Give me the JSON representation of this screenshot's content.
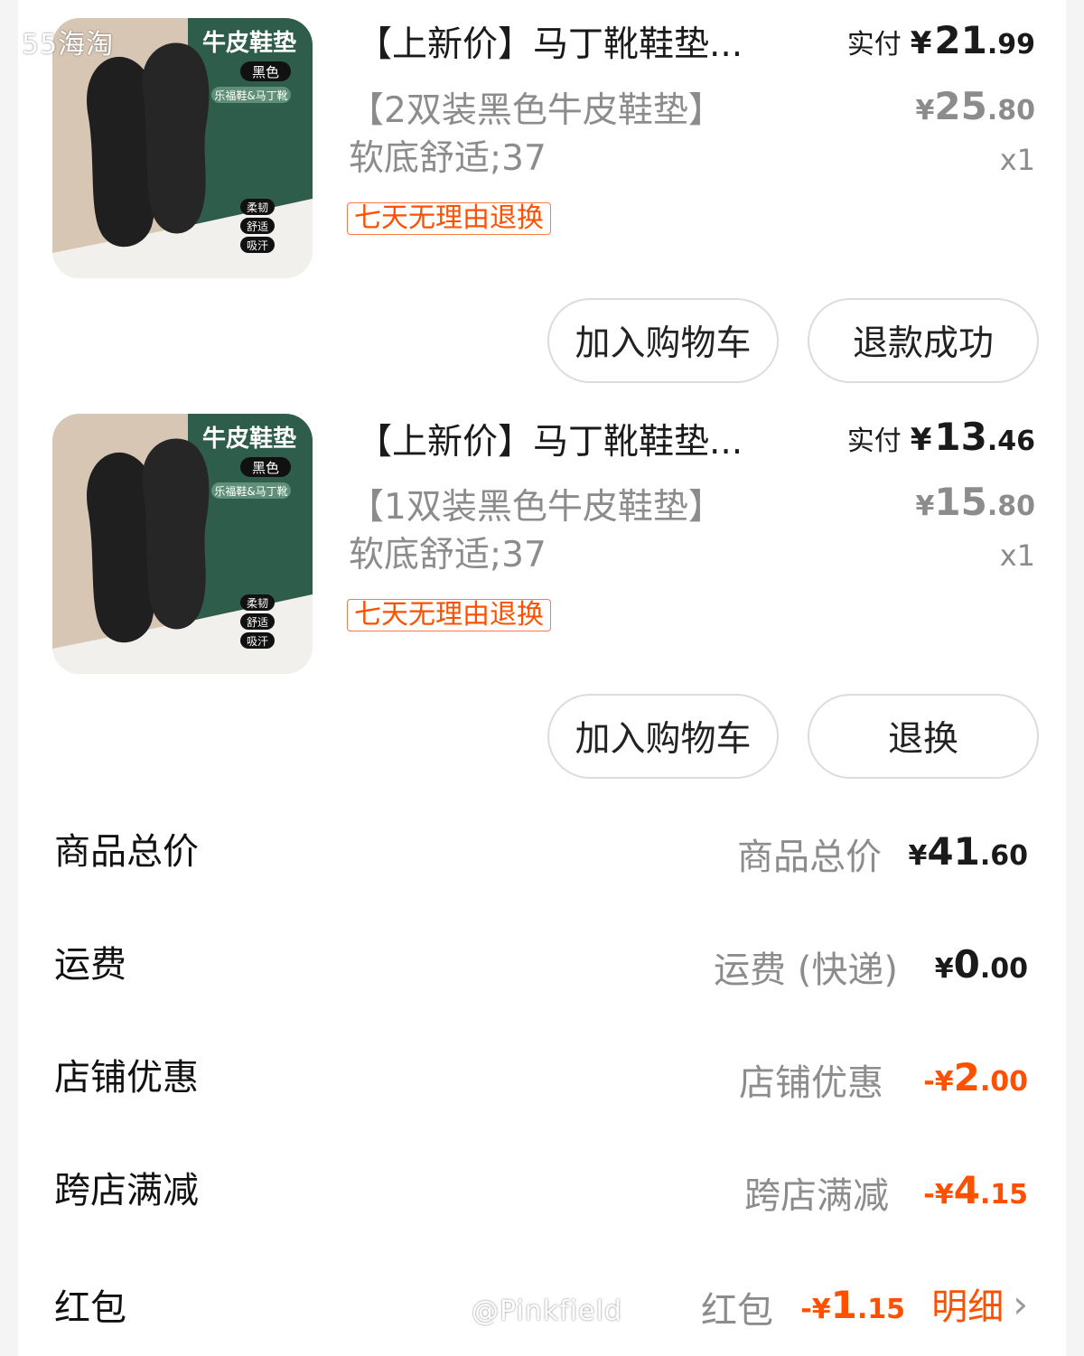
{
  "watermark_top": "55海淘",
  "watermark_bottom": "@Pinkfield",
  "items": [
    {
      "thumb": {
        "tag": "牛皮鞋垫",
        "badge": "黑色",
        "subtag": "乐福鞋&马丁靴",
        "features": [
          "柔韧",
          "舒适",
          "吸汗"
        ]
      },
      "title": "【上新价】马丁靴鞋垫...",
      "spec": [
        "【2双装黑色牛皮鞋垫】",
        "软底舒适;37"
      ],
      "tag": "七天无理由退换",
      "paid_label": "实付",
      "paid_yen": "¥",
      "paid_int": "21",
      "paid_dec": ".99",
      "orig_yen": "¥",
      "orig_int": "25",
      "orig_dec": ".80",
      "qty": "x1",
      "btn_cart": "加入购物车",
      "btn_status": "退款成功"
    },
    {
      "thumb": {
        "tag": "牛皮鞋垫",
        "badge": "黑色",
        "subtag": "乐福鞋&马丁靴",
        "features": [
          "柔韧",
          "舒适",
          "吸汗"
        ]
      },
      "title": "【上新价】马丁靴鞋垫...",
      "spec": [
        "【1双装黑色牛皮鞋垫】",
        "软底舒适;37"
      ],
      "tag": "七天无理由退换",
      "paid_label": "实付",
      "paid_yen": "¥",
      "paid_int": "13",
      "paid_dec": ".46",
      "orig_yen": "¥",
      "orig_int": "15",
      "orig_dec": ".80",
      "qty": "x1",
      "btn_cart": "加入购物车",
      "btn_status": "退换"
    }
  ],
  "summary": [
    {
      "label": "商品总价",
      "sub": "商品总价",
      "sign": "",
      "yen": "¥",
      "int": "41",
      "dec": ".60",
      "discount": false
    },
    {
      "label": "运费",
      "sub": "运费 (快递)",
      "sign": "",
      "yen": "¥",
      "int": "0",
      "dec": ".00",
      "discount": false
    },
    {
      "label": "店铺优惠",
      "sub": "店铺优惠",
      "sign": "-",
      "yen": "¥",
      "int": "2",
      "dec": ".00",
      "discount": true
    },
    {
      "label": "跨店满减",
      "sub": "跨店满减",
      "sign": "-",
      "yen": "¥",
      "int": "4",
      "dec": ".15",
      "discount": true
    },
    {
      "label": "红包",
      "sub": "红包",
      "sign": "-",
      "yen": "¥",
      "int": "1",
      "dec": ".15",
      "discount": true,
      "detail": "明细"
    }
  ],
  "colors": {
    "accent": "#ff5000",
    "muted": "#8c8c8c",
    "thumb_green": "#2e5d4b",
    "insole": "#1f1f1f"
  }
}
